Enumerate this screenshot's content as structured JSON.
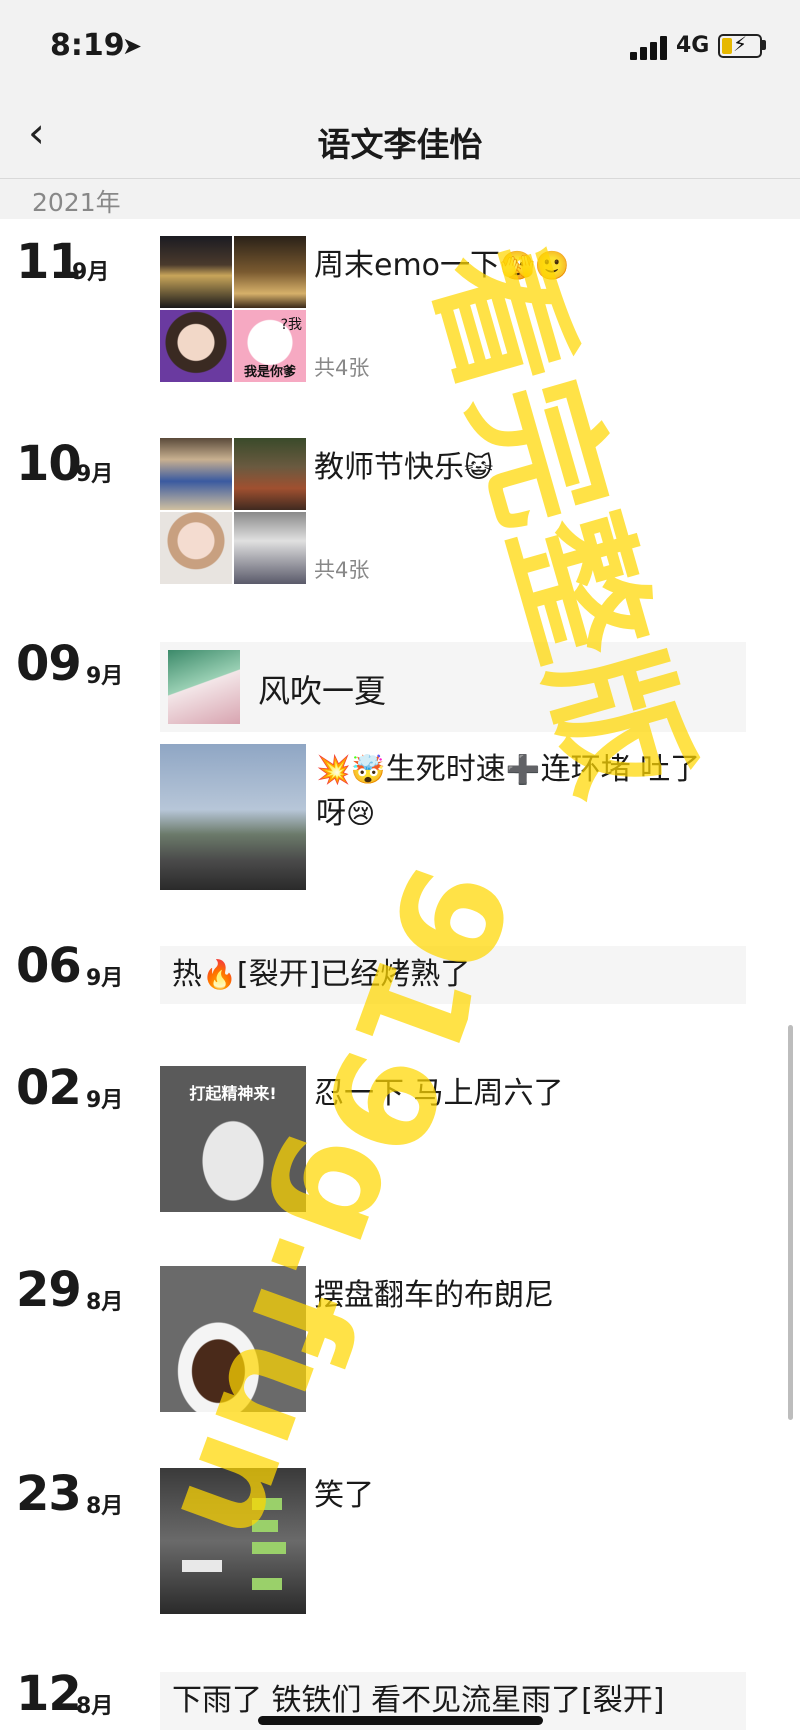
{
  "status": {
    "time": "8:19",
    "network": "4G",
    "location_icon": "location-arrow-icon",
    "signal_icon": "signal-bars-icon",
    "battery_icon": "battery-charging-icon"
  },
  "nav": {
    "back_icon": "chevron-left-icon",
    "title": "语文李佳怡"
  },
  "year": "2021年",
  "entries": [
    {
      "day": "11",
      "month": "9月",
      "caption": "周末emo一下",
      "emoji": "🫣🙂",
      "count": "共4张"
    },
    {
      "day": "10",
      "month": "9月",
      "caption": "教师节快乐",
      "emoji": "😺",
      "count": "共4张"
    },
    {
      "day": "09",
      "month": "9月",
      "share_text": "风吹一夏",
      "caption": "生死时速",
      "caption_prefix": "💥🤯",
      "caption_mid": "➕",
      "caption_rest": "连环堵 吐了",
      "caption_line2": "呀",
      "caption_emoji2": "😢"
    },
    {
      "day": "06",
      "month": "9月",
      "caption": "热",
      "caption_emoji": "🔥",
      "caption_rest": "[裂开]已经烤熟了"
    },
    {
      "day": "02",
      "month": "9月",
      "caption": "忍一下 马上周六了",
      "image_text": "打起精神来!"
    },
    {
      "day": "29",
      "month": "8月",
      "caption": "摆盘翻车的布朗尼"
    },
    {
      "day": "23",
      "month": "8月",
      "caption": "笑了"
    },
    {
      "day": "12",
      "month": "8月",
      "caption": "下雨了 铁铁们 看不见流星雨了[裂开]"
    }
  ],
  "thumb_labels": {
    "e11_sticker": "我是你爹",
    "e11_sticker_q": "?我"
  },
  "watermark": {
    "line1": "看完整版",
    "line2": "919g.fun"
  },
  "colors": {
    "watermark": "#FFD700",
    "nav_bg": "#F2F2F2",
    "card_bg": "#F5F5F5",
    "muted_text": "#888888"
  }
}
